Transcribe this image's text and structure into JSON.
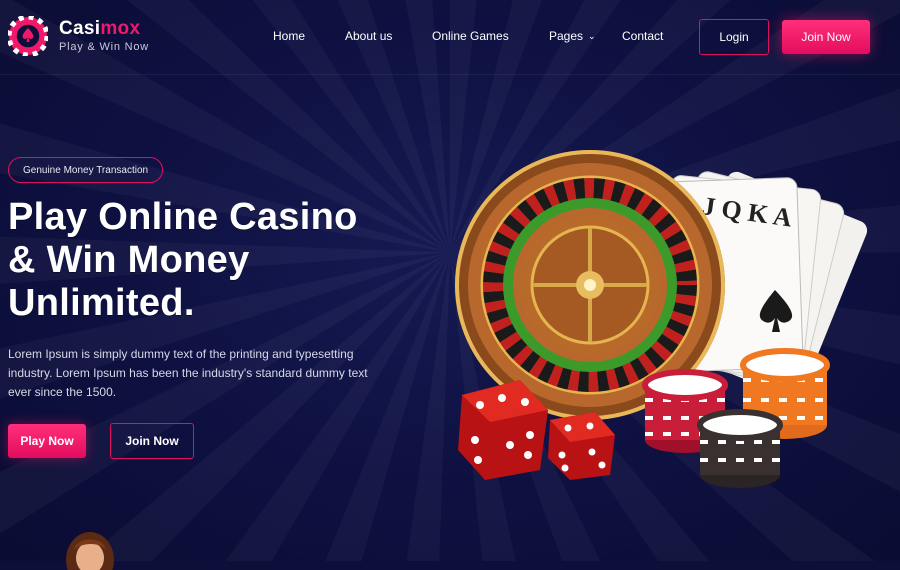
{
  "brand": {
    "name_part1": "Casi",
    "name_part2": "mox",
    "tagline": "Play & Win Now",
    "accent_color": "#f0186a",
    "background_color": "#0d0f3a"
  },
  "nav": {
    "items": [
      {
        "label": "Home"
      },
      {
        "label": "About us"
      },
      {
        "label": "Online Games"
      },
      {
        "label": "Pages",
        "has_dropdown": true
      },
      {
        "label": "Contact"
      }
    ],
    "login_label": "Login",
    "join_label": "Join Now"
  },
  "hero": {
    "badge": "Genuine Money Transaction",
    "headline_line1": "Play Online Casino",
    "headline_line2": "& Win Money",
    "headline_line3": "Unlimited.",
    "description": "Lorem Ipsum is simply dummy text of the printing and typesetting industry. Lorem Ipsum has been the industry's standard dummy text ever since the 1500.",
    "play_label": "Play Now",
    "join_label": "Join Now"
  },
  "icons": {
    "logo": "casino-chip-icon",
    "pages_chevron": "chevron-down-icon"
  }
}
